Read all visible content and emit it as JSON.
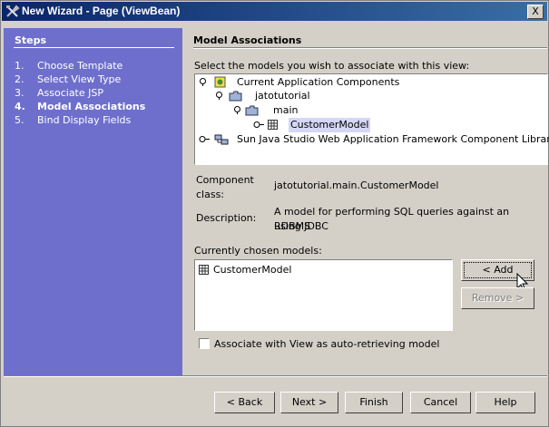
{
  "window": {
    "title": "New Wizard - Page (ViewBean)",
    "close_label": "X"
  },
  "steps": {
    "header": "Steps",
    "items": [
      {
        "num": "1.",
        "label": "Choose Template"
      },
      {
        "num": "2.",
        "label": "Select View Type"
      },
      {
        "num": "3.",
        "label": "Associate JSP"
      },
      {
        "num": "4.",
        "label": "Model Associations",
        "current": true
      },
      {
        "num": "5.",
        "label": "Bind Display Fields"
      }
    ]
  },
  "main": {
    "header": "Model Associations",
    "instruction": "Select the models you wish to associate with this view:",
    "tree": [
      {
        "label": "Current Application Components",
        "icon": "app-components-icon"
      },
      {
        "label": "jatotutorial",
        "icon": "folder-icon"
      },
      {
        "label": "main",
        "icon": "folder-icon"
      },
      {
        "label": "CustomerModel",
        "icon": "model-icon",
        "selected": true
      },
      {
        "label": "Sun Java Studio Web Application Framework Component Library",
        "icon": "library-icon"
      }
    ],
    "component_class_label": "Component class:",
    "component_class_value": "jatotutorial.main.CustomerModel",
    "description_label": "Description:",
    "description_value_line1": "A model for performing SQL queries against an RDBMS",
    "description_value_line2": "using JDBC",
    "chosen_label": "Currently chosen models:",
    "chosen_items": [
      "CustomerModel"
    ],
    "add_button": "< Add",
    "remove_button": "Remove >",
    "checkbox_label": "Associate with View as auto-retrieving model"
  },
  "footer": {
    "back": "< Back",
    "next": "Next >",
    "finish": "Finish",
    "cancel": "Cancel",
    "help": "Help"
  },
  "colors": {
    "titlebar": "#0a246a",
    "steps_bg": "#6e6fcc",
    "window_bg": "#d4d0c8",
    "selection": "#d5d7f7"
  }
}
